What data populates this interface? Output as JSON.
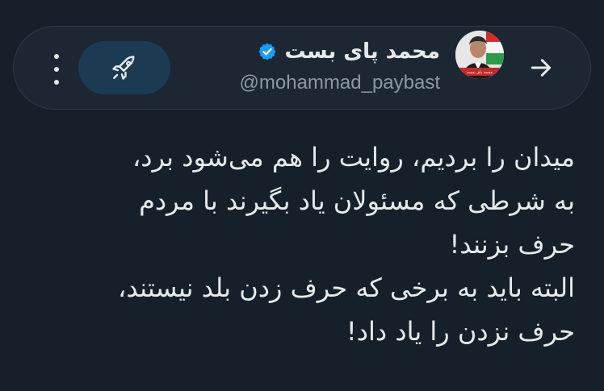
{
  "header": {
    "author_name": "محمد پای بست",
    "author_handle": "@mohammad_paybast",
    "verified": true,
    "back_icon": "arrow-right-icon",
    "boost_icon": "rocket-icon",
    "more_icon": "more-vertical-icon",
    "verified_icon": "verified-badge-icon",
    "avatar_caption": "محمد پای بست"
  },
  "tweet": {
    "lines": [
      "میدان را بردیم، روایت را هم می‌شود برد،",
      "به شرطی که مسئولان یاد بگیرند با مردم",
      "حرف بزنند!",
      "البته باید به برخی که حرف زدن بلد نیستند،",
      "حرف نزدن را یاد داد!"
    ]
  },
  "colors": {
    "background": "#15202b",
    "header_bg": "#1c2733",
    "boost_bg": "#1d3a53",
    "verified": "#1d9bf0",
    "text_primary": "#e7e9ea",
    "text_secondary": "#8b98a5"
  }
}
